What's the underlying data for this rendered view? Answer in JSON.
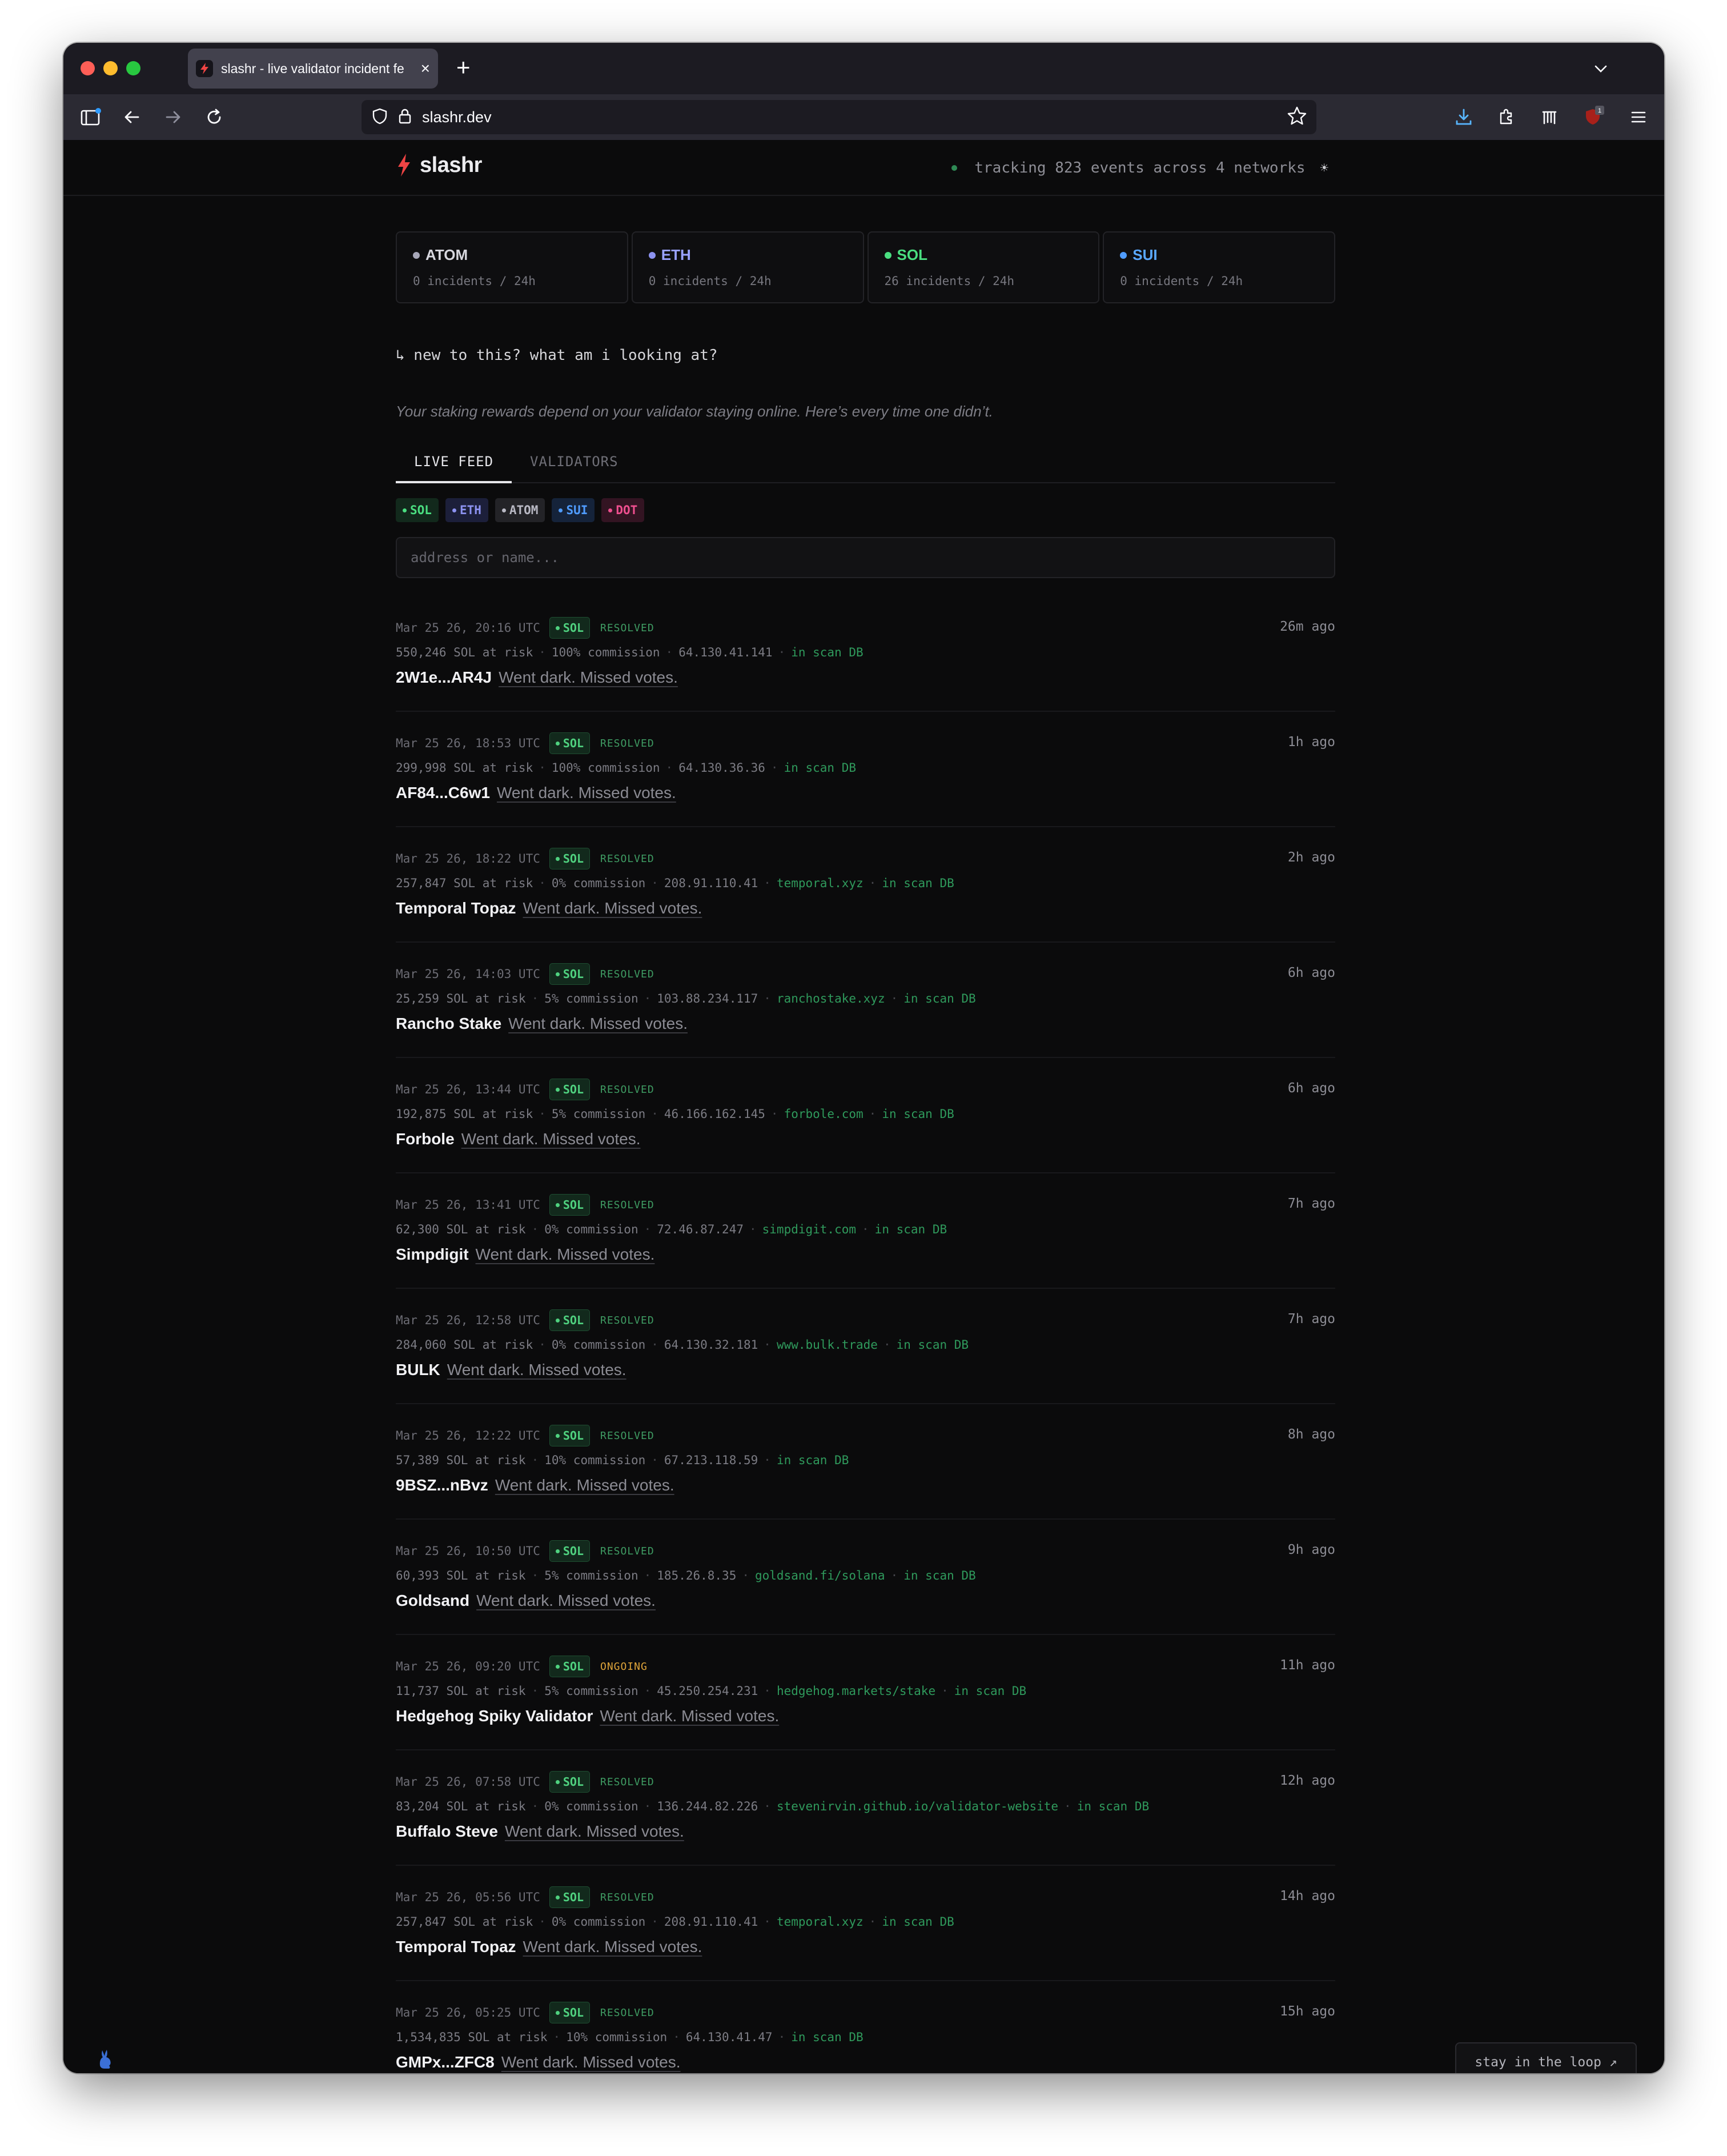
{
  "browser": {
    "tab_title": "slashr - live validator incident fe",
    "tab_close": "×",
    "new_tab": "+",
    "url": "slashr.dev",
    "ext_badge": "1"
  },
  "header": {
    "logo": "slashr",
    "tracking": "tracking 823 events across 4 networks"
  },
  "networks": [
    {
      "name": "ATOM",
      "incidents": "0 incidents / 24h",
      "color": "#a7a7b8",
      "text_color": "#d7d7de"
    },
    {
      "name": "ETH",
      "incidents": "0 incidents / 24h",
      "color": "#8c92f0",
      "text_color": "#9aa2ff"
    },
    {
      "name": "SOL",
      "incidents": "26 incidents / 24h",
      "color": "#4ade80",
      "text_color": "#4ade80"
    },
    {
      "name": "SUI",
      "incidents": "0 incidents / 24h",
      "color": "#4f9cff",
      "text_color": "#5aa8ff"
    }
  ],
  "intro": {
    "question": "↳ new to this? what am i looking at?",
    "description": "Your staking rewards depend on your validator staying online. Here’s every time one didn’t."
  },
  "tabs": [
    "LIVE FEED",
    "VALIDATORS"
  ],
  "filters": [
    {
      "label": "SOL",
      "color": "#4ade80",
      "bg": "#12291c"
    },
    {
      "label": "ETH",
      "color": "#8c92f0",
      "bg": "#1c1f3a"
    },
    {
      "label": "ATOM",
      "color": "#b9b9c4",
      "bg": "#232327"
    },
    {
      "label": "SUI",
      "color": "#4f9cff",
      "bg": "#15233a"
    },
    {
      "label": "DOT",
      "color": "#ef4f8f",
      "bg": "#331422"
    }
  ],
  "search": {
    "placeholder": "address or name..."
  },
  "events": [
    {
      "time": "Mar 25 26, 20:16 UTC",
      "chain": "SOL",
      "status": "RESOLVED",
      "ago": "26m ago",
      "stake": "550,246 SOL at risk",
      "commission": "100% commission",
      "ip": "64.130.41.141",
      "site": "",
      "scan": "in scan DB",
      "name": "2W1e...AR4J",
      "desc": "Went dark. Missed votes."
    },
    {
      "time": "Mar 25 26, 18:53 UTC",
      "chain": "SOL",
      "status": "RESOLVED",
      "ago": "1h ago",
      "stake": "299,998 SOL at risk",
      "commission": "100% commission",
      "ip": "64.130.36.36",
      "site": "",
      "scan": "in scan DB",
      "name": "AF84...C6w1",
      "desc": "Went dark. Missed votes."
    },
    {
      "time": "Mar 25 26, 18:22 UTC",
      "chain": "SOL",
      "status": "RESOLVED",
      "ago": "2h ago",
      "stake": "257,847 SOL at risk",
      "commission": "0% commission",
      "ip": "208.91.110.41",
      "site": "temporal.xyz",
      "scan": "in scan DB",
      "name": "Temporal Topaz",
      "desc": "Went dark. Missed votes."
    },
    {
      "time": "Mar 25 26, 14:03 UTC",
      "chain": "SOL",
      "status": "RESOLVED",
      "ago": "6h ago",
      "stake": "25,259 SOL at risk",
      "commission": "5% commission",
      "ip": "103.88.234.117",
      "site": "ranchostake.xyz",
      "scan": "in scan DB",
      "name": "Rancho Stake",
      "desc": "Went dark. Missed votes."
    },
    {
      "time": "Mar 25 26, 13:44 UTC",
      "chain": "SOL",
      "status": "RESOLVED",
      "ago": "6h ago",
      "stake": "192,875 SOL at risk",
      "commission": "5% commission",
      "ip": "46.166.162.145",
      "site": "forbole.com",
      "scan": "in scan DB",
      "name": "Forbole",
      "desc": "Went dark. Missed votes."
    },
    {
      "time": "Mar 25 26, 13:41 UTC",
      "chain": "SOL",
      "status": "RESOLVED",
      "ago": "7h ago",
      "stake": "62,300 SOL at risk",
      "commission": "0% commission",
      "ip": "72.46.87.247",
      "site": "simpdigit.com",
      "scan": "in scan DB",
      "name": "Simpdigit",
      "desc": "Went dark. Missed votes."
    },
    {
      "time": "Mar 25 26, 12:58 UTC",
      "chain": "SOL",
      "status": "RESOLVED",
      "ago": "7h ago",
      "stake": "284,060 SOL at risk",
      "commission": "0% commission",
      "ip": "64.130.32.181",
      "site": "www.bulk.trade",
      "scan": "in scan DB",
      "name": "BULK",
      "desc": "Went dark. Missed votes."
    },
    {
      "time": "Mar 25 26, 12:22 UTC",
      "chain": "SOL",
      "status": "RESOLVED",
      "ago": "8h ago",
      "stake": "57,389 SOL at risk",
      "commission": "10% commission",
      "ip": "67.213.118.59",
      "site": "",
      "scan": "in scan DB",
      "name": "9BSZ...nBvz",
      "desc": "Went dark. Missed votes."
    },
    {
      "time": "Mar 25 26, 10:50 UTC",
      "chain": "SOL",
      "status": "RESOLVED",
      "ago": "9h ago",
      "stake": "60,393 SOL at risk",
      "commission": "5% commission",
      "ip": "185.26.8.35",
      "site": "goldsand.fi/solana",
      "scan": "in scan DB",
      "name": "Goldsand",
      "desc": "Went dark. Missed votes."
    },
    {
      "time": "Mar 25 26, 09:20 UTC",
      "chain": "SOL",
      "status": "ONGOING",
      "ago": "11h ago",
      "stake": "11,737 SOL at risk",
      "commission": "5% commission",
      "ip": "45.250.254.231",
      "site": "hedgehog.markets/stake",
      "scan": "in scan DB",
      "name": "Hedgehog Spiky Validator",
      "desc": "Went dark. Missed votes."
    },
    {
      "time": "Mar 25 26, 07:58 UTC",
      "chain": "SOL",
      "status": "RESOLVED",
      "ago": "12h ago",
      "stake": "83,204 SOL at risk",
      "commission": "0% commission",
      "ip": "136.244.82.226",
      "site": "stevenirvin.github.io/validator-website",
      "scan": "in scan DB",
      "name": "Buffalo Steve",
      "desc": "Went dark. Missed votes."
    },
    {
      "time": "Mar 25 26, 05:56 UTC",
      "chain": "SOL",
      "status": "RESOLVED",
      "ago": "14h ago",
      "stake": "257,847 SOL at risk",
      "commission": "0% commission",
      "ip": "208.91.110.41",
      "site": "temporal.xyz",
      "scan": "in scan DB",
      "name": "Temporal Topaz",
      "desc": "Went dark. Missed votes."
    },
    {
      "time": "Mar 25 26, 05:25 UTC",
      "chain": "SOL",
      "status": "RESOLVED",
      "ago": "15h ago",
      "stake": "1,534,835 SOL at risk",
      "commission": "10% commission",
      "ip": "64.130.41.47",
      "site": "",
      "scan": "in scan DB",
      "name": "GMPx...ZFC8",
      "desc": "Went dark. Missed votes."
    }
  ],
  "cta": {
    "label": "stay in the loop ↗"
  },
  "colors": {
    "accent_red": "#ef4444",
    "resolved": "#3f9c63",
    "ongoing": "#e0a53a"
  }
}
